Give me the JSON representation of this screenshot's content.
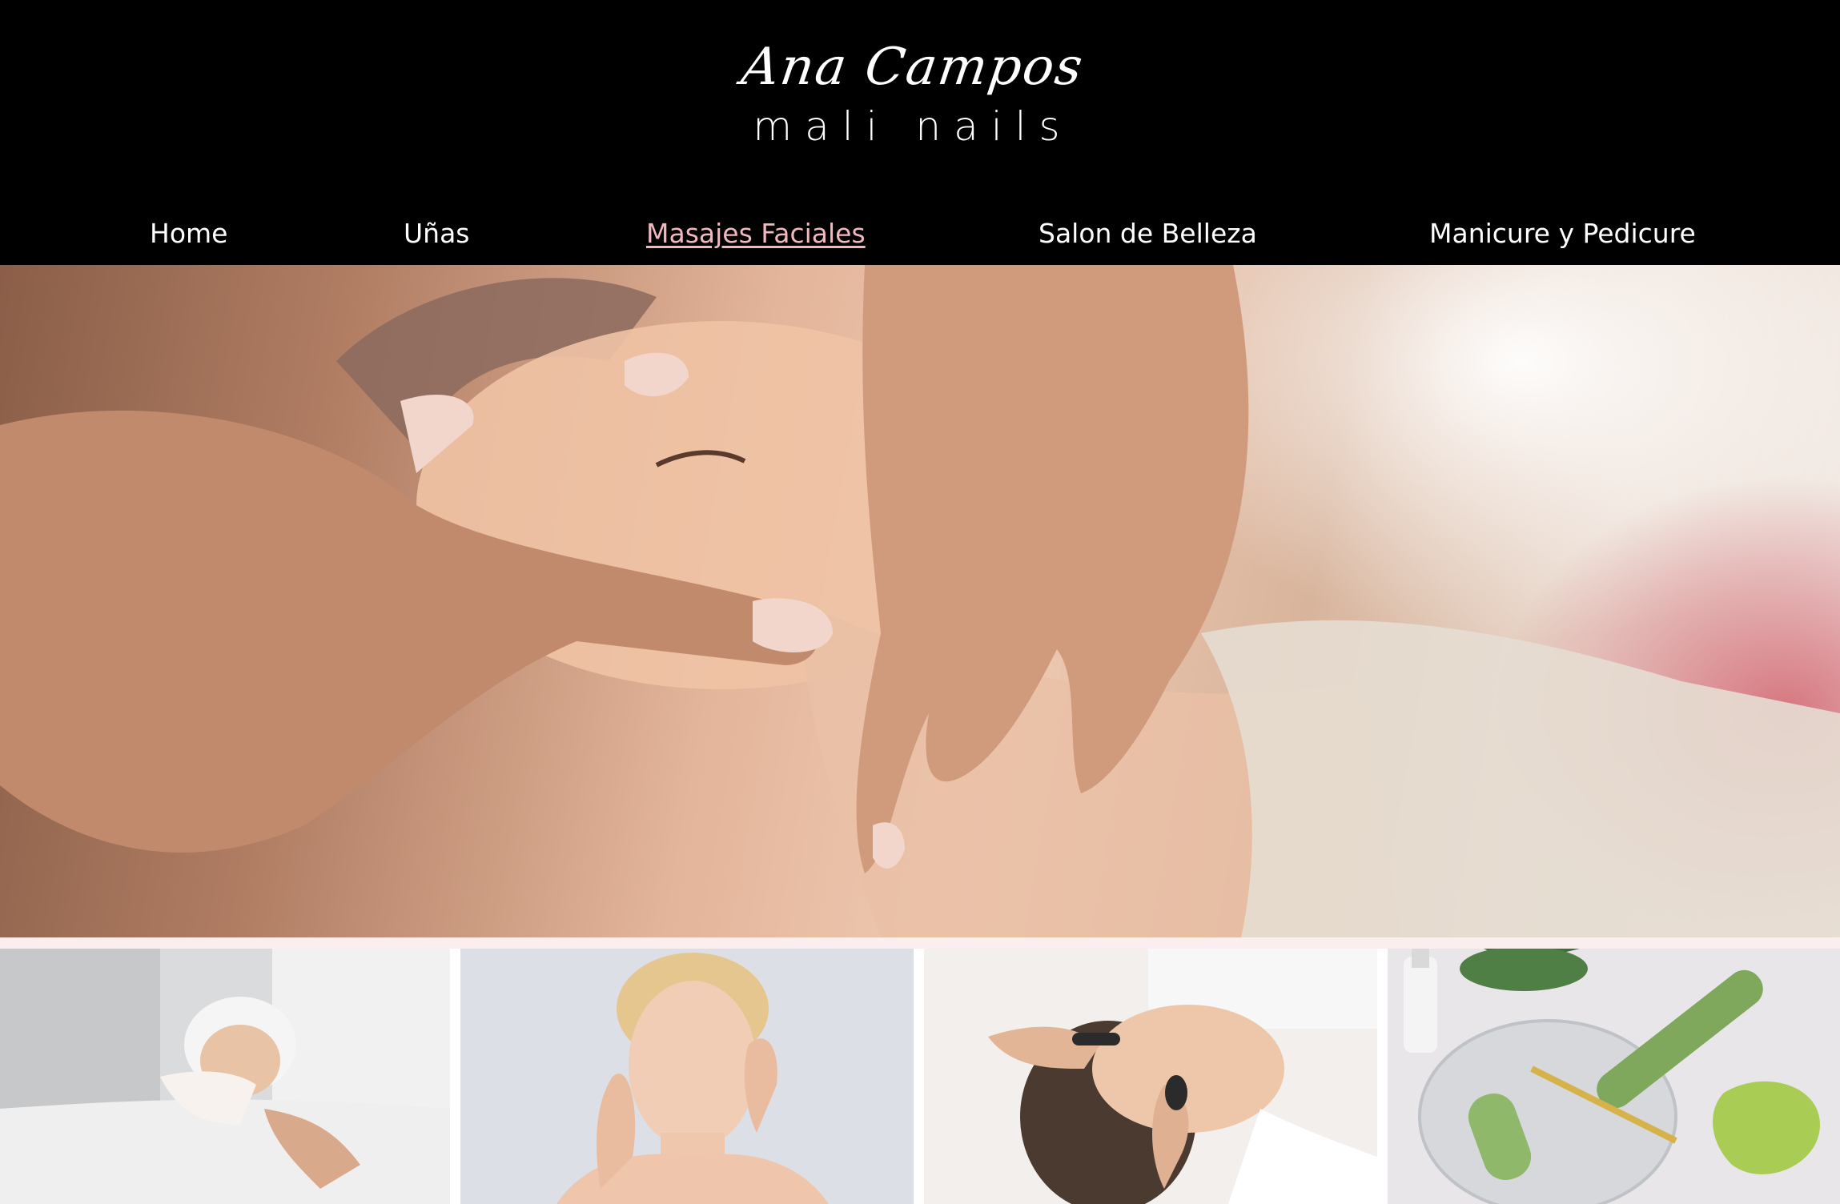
{
  "brand": {
    "script": "Ana Campos",
    "wordmark": "mali nails"
  },
  "nav": {
    "items": [
      {
        "label": "Home",
        "active": false
      },
      {
        "label": "Uñas",
        "active": false
      },
      {
        "label": "Masajes Faciales",
        "active": true
      },
      {
        "label": "Salon de Belleza",
        "active": false
      },
      {
        "label": "Manicure y Pedicure",
        "active": false
      }
    ]
  },
  "colors": {
    "header_bg": "#000000",
    "nav_text": "#ffffff",
    "nav_active": "#f2b8c0"
  },
  "images": {
    "hero": "facial-massage-photo",
    "thumbnails": [
      "facial-treatment-photo",
      "skincare-woman-photo",
      "gua-sha-stone-massage-photo",
      "jade-roller-photo"
    ]
  }
}
